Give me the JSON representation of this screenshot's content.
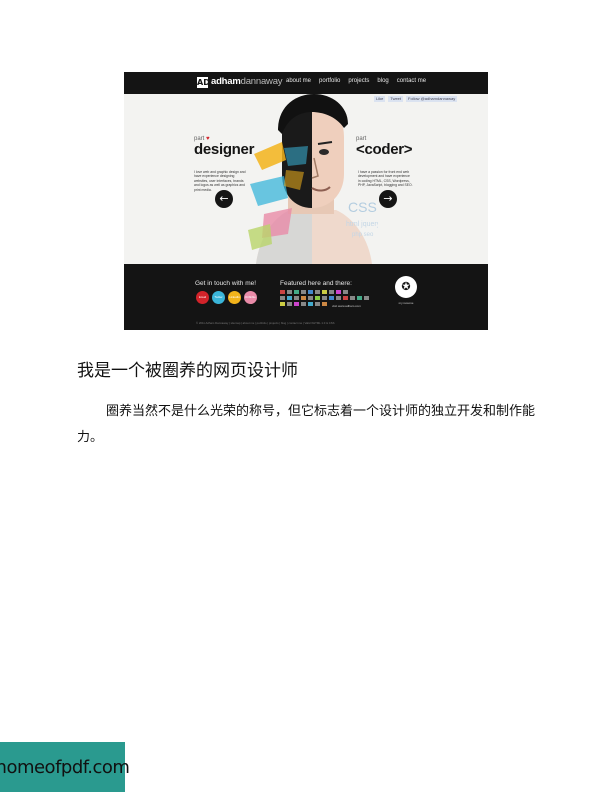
{
  "screenshot": {
    "logo_mark": "AD",
    "logo_first": "adham",
    "logo_last": "dannaway",
    "nav": [
      "about me",
      "portfolio",
      "projects",
      "blog",
      "contact me"
    ],
    "social": [
      "Like",
      "Tweet",
      "Follow @adhamdannaway"
    ],
    "left_part": "part",
    "left_title": "designer",
    "left_blurb": "I love web and graphic design and have experience designing websites, user interfaces, brands and logos as well as graphics and print media.",
    "right_part": "part",
    "right_title": "<coder>",
    "right_blurb": "I have a passion for front end web development and have experience in coding HTML, CSS, Wordpress, PHP, JavaScript, blogging and SEO.",
    "footer_contact_title": "Get in touch with me!",
    "footer_featured_title": "Featured here and there:",
    "contact_buttons": [
      {
        "label": "Email",
        "color": "#d2232a"
      },
      {
        "label": "Twitter",
        "color": "#3ab5d9"
      },
      {
        "label": "LinkedIn",
        "color": "#f2b31b"
      },
      {
        "label": "Dribbble",
        "color": "#e98ba8"
      }
    ],
    "subscribe": "visit www.adham.com",
    "resume_label": "my resume",
    "footer_links": "© 2011 Adham Dannaway  |  sitemap  |  about me  |  portfolio  |  projects  |  blog  |  contact me  |  Valid XHTML 1.0 & CSS"
  },
  "article": {
    "heading": "我是一个被圈养的网页设计师",
    "paragraph": "圈养当然不是什么光荣的称号，但它标志着一个设计师的独立开发和制作能力。"
  },
  "watermark": "homeofpdf.com",
  "colors": {
    "dark": "#141414",
    "accent_red": "#d2232a",
    "watermark_bg": "#2a9a8f"
  }
}
